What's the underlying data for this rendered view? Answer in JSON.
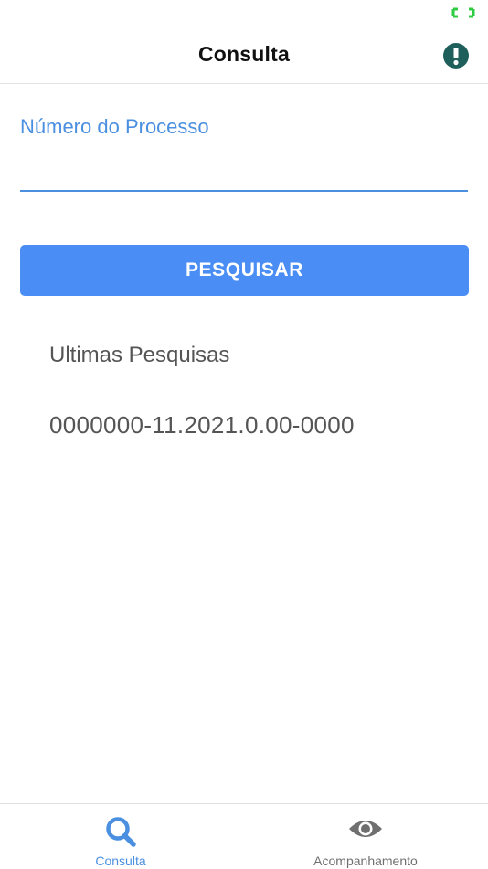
{
  "status_bar": {
    "battery_icon": "battery-icon",
    "battery_color": "#2ecc40"
  },
  "header": {
    "title": "Consulta",
    "info_icon": "exclamation-circle-icon",
    "info_color": "#1f5f5b"
  },
  "form": {
    "label": "Número do Processo",
    "input_value": "",
    "search_button_label": "PESQUISAR",
    "accent_color": "#4a8fe0",
    "button_color": "#4a8ef5"
  },
  "recent": {
    "title": "Ultimas Pesquisas",
    "items": [
      "0000000-11.2021.0.00-0000"
    ]
  },
  "tab_bar": {
    "tabs": [
      {
        "label": "Consulta",
        "icon": "search-icon",
        "active": true
      },
      {
        "label": "Acompanhamento",
        "icon": "eye-icon",
        "active": false
      }
    ]
  }
}
